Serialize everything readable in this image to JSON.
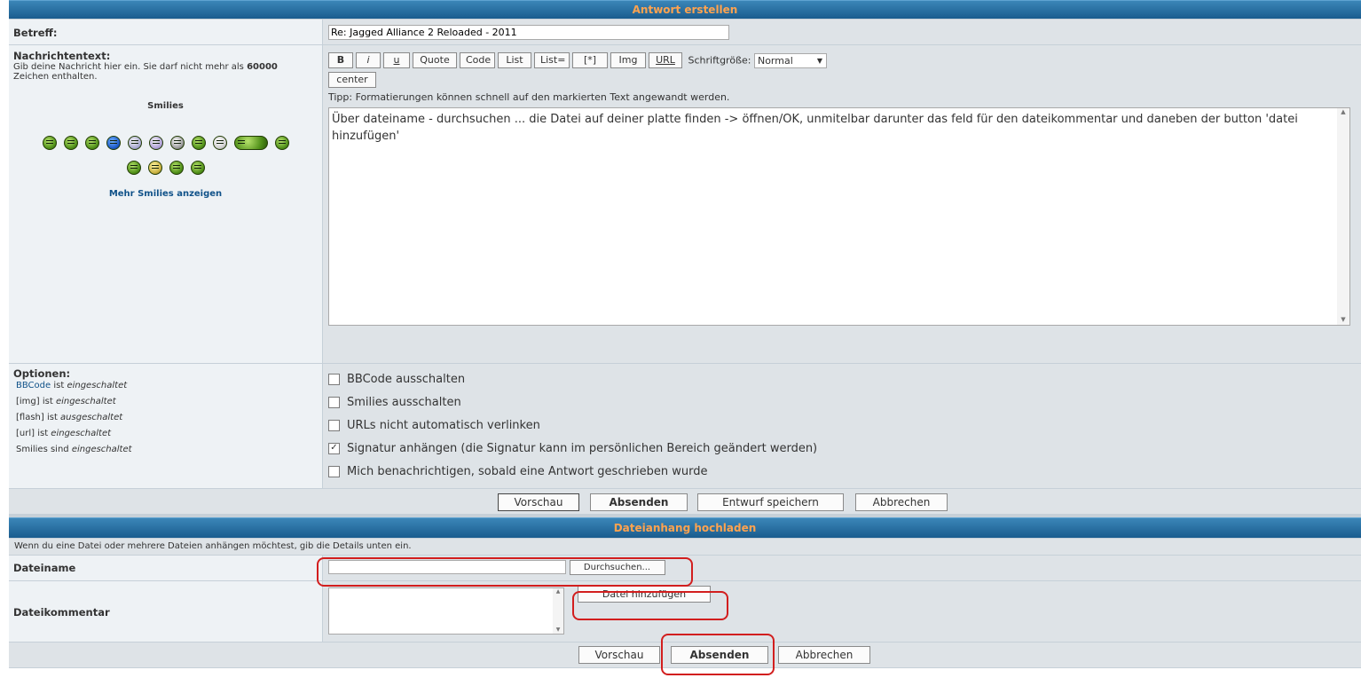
{
  "reply": {
    "header": "Antwort erstellen",
    "subject_label": "Betreff:",
    "subject_value": "Re: Jagged Alliance 2 Reloaded - 2011",
    "message_label": "Nachrichtentext:",
    "message_hint_a": "Gib deine Nachricht hier ein. Sie darf nicht mehr als ",
    "message_hint_max": "60000",
    "message_hint_b": "Zeichen enthalten.",
    "smilies_title": "Smilies",
    "more_smilies": "Mehr Smilies anzeigen",
    "format_buttons": {
      "bold": "B",
      "italic": "i",
      "underline": "u",
      "quote": "Quote",
      "code": "Code",
      "list": "List",
      "list_eq": "List=",
      "star": "[*]",
      "img": "Img",
      "url": "URL",
      "center": "center"
    },
    "font_size_label": "Schriftgröße:",
    "font_size_value": "Normal",
    "tip": "Tipp: Formatierungen können schnell auf den markierten Text angewandt werden.",
    "message_text": "Über dateiname - durchsuchen ... die Datei auf deiner platte finden -> öffnen/OK, unmitelbar darunter das feld für den dateikommentar und daneben der button 'datei hinzufügen'",
    "options_label": "Optionen:",
    "status": {
      "bbcode_link": "BBCode",
      "bbcode_rest": " ist ",
      "bbcode_state": "eingeschaltet",
      "img": "[img] ist ",
      "img_state": "eingeschaltet",
      "flash": "[flash] ist ",
      "flash_state": "ausgeschaltet",
      "url": "[url] ist ",
      "url_state": "eingeschaltet",
      "smilies": "Smilies sind ",
      "smilies_state": "eingeschaltet"
    },
    "options": {
      "bbcode": "BBCode ausschalten",
      "smilies": "Smilies ausschalten",
      "urls": "URLs nicht automatisch verlinken",
      "signature": "Signatur anhängen (die Signatur kann im persönlichen Bereich geändert werden)",
      "notify": "Mich benachrichtigen, sobald eine Antwort geschrieben wurde"
    },
    "actions": {
      "preview": "Vorschau",
      "submit": "Absenden",
      "draft": "Entwurf speichern",
      "cancel": "Abbrechen"
    }
  },
  "upload": {
    "header": "Dateianhang hochladen",
    "hint": "Wenn du eine Datei oder mehrere Dateien anhängen möchtest, gib die Details unten ein.",
    "filename_label": "Dateiname",
    "browse": "Durchsuchen...",
    "comment_label": "Dateikommentar",
    "add_file": "Datei hinzufügen",
    "actions": {
      "preview": "Vorschau",
      "submit": "Absenden",
      "cancel": "Abbrechen"
    }
  },
  "colors": {
    "header_text": "#ffa34f",
    "header_bg": "#1a5c8e",
    "highlight": "#d21e1e",
    "link": "#105289"
  }
}
